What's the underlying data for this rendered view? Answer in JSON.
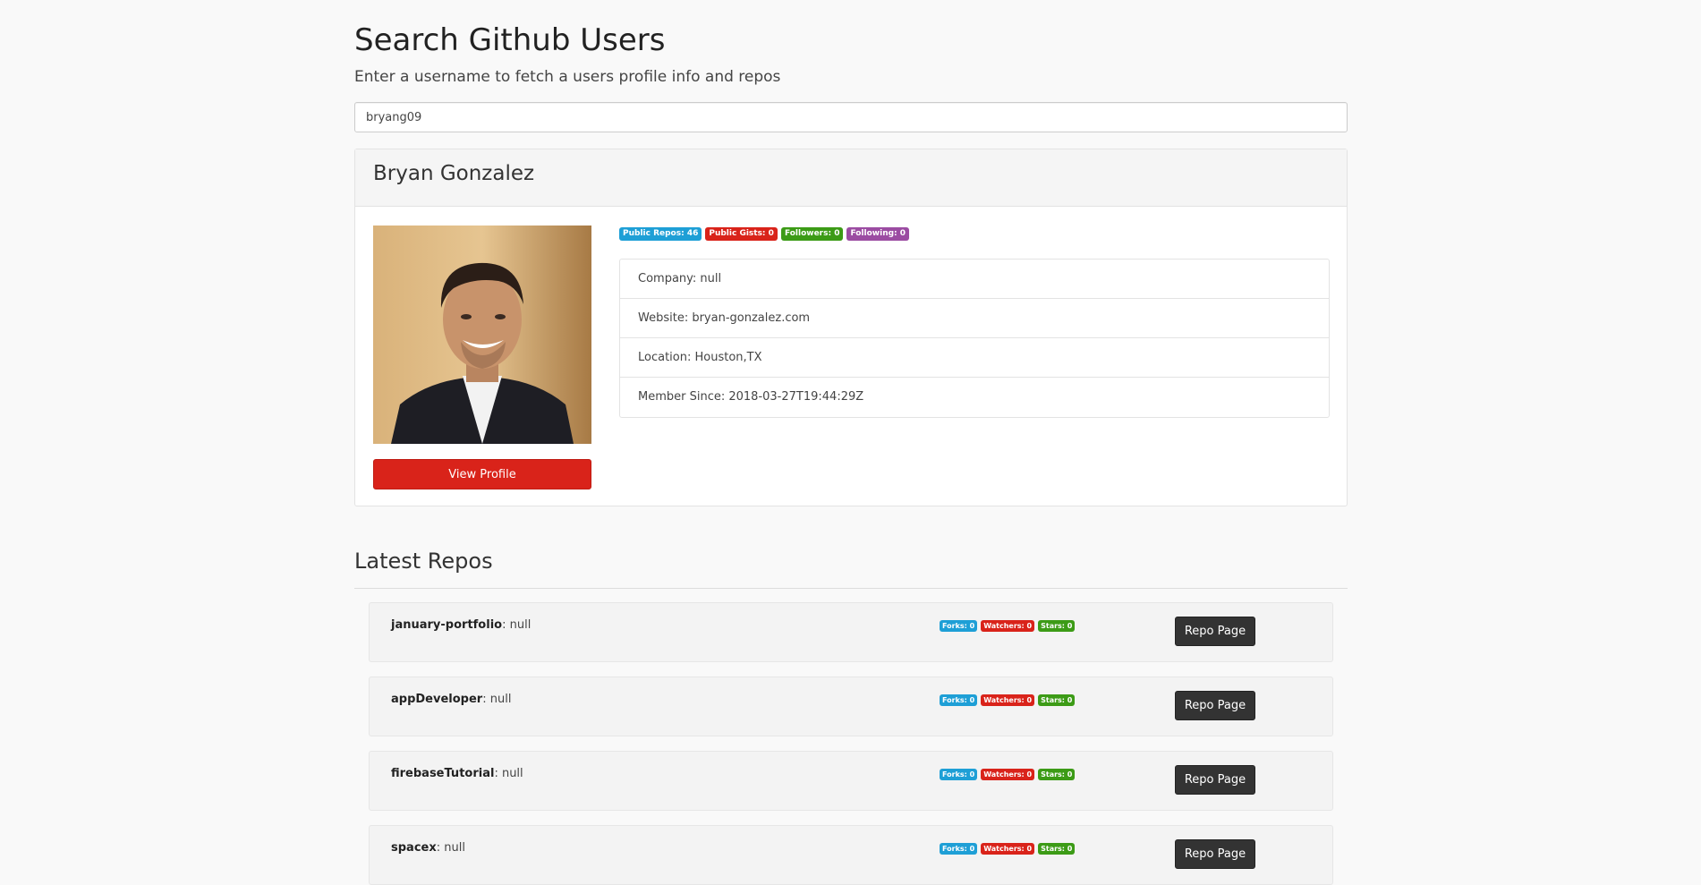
{
  "header": {
    "title": "Search Github Users",
    "subtitle": "Enter a username to fetch a users profile info and repos"
  },
  "search": {
    "value": "bryang09"
  },
  "profile": {
    "name": "Bryan Gonzalez",
    "view_profile_label": "View Profile",
    "badges": {
      "public_repos": "Public Repos: 46",
      "public_gists": "Public Gists: 0",
      "followers": "Followers: 0",
      "following": "Following: 0"
    },
    "info": {
      "company": "Company: null",
      "website": "Website: bryan-gonzalez.com",
      "location": "Location: Houston,TX",
      "member_since": "Member Since: 2018-03-27T19:44:29Z"
    }
  },
  "repos": {
    "title": "Latest Repos",
    "items": [
      {
        "name": "january-portfolio",
        "description": ": null",
        "forks": "Forks: 0",
        "watchers": "Watchers: 0",
        "stars": "Stars: 0",
        "button": "Repo Page"
      },
      {
        "name": "appDeveloper",
        "description": ": null",
        "forks": "Forks: 0",
        "watchers": "Watchers: 0",
        "stars": "Stars: 0",
        "button": "Repo Page"
      },
      {
        "name": "firebaseTutorial",
        "description": ": null",
        "forks": "Forks: 0",
        "watchers": "Watchers: 0",
        "stars": "Stars: 0",
        "button": "Repo Page"
      },
      {
        "name": "spacex",
        "description": ": null",
        "forks": "Forks: 0",
        "watchers": "Watchers: 0",
        "stars": "Stars: 0",
        "button": "Repo Page"
      }
    ]
  },
  "colors": {
    "badge_blue": "#1e9fd6",
    "badge_red": "#d9231a",
    "badge_green": "#3c9b16",
    "badge_purple": "#9b4ca2",
    "view_profile_button": "#d9231a",
    "repo_button": "#333333"
  }
}
